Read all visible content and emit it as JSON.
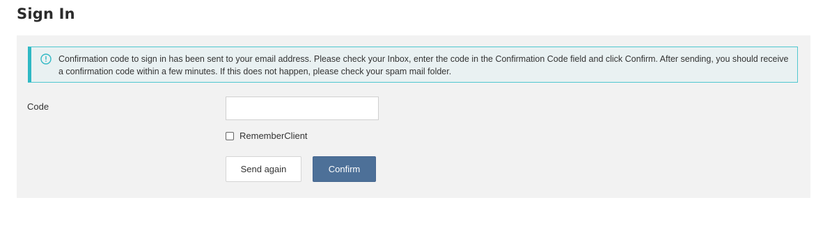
{
  "page": {
    "title": "Sign In"
  },
  "alert": {
    "icon": "info-circle-icon",
    "message": "Confirmation code to sign in has been sent to your email address. Please check your Inbox, enter the code in the Confirmation Code field and click Confirm. After sending, you should receive a confirmation code within a few minutes. If this does not happen, please check your spam mail folder.",
    "border_color": "#4fc7cf",
    "accent_color": "#2fb8c4"
  },
  "form": {
    "code_label": "Code",
    "code_value": "",
    "remember_label": "RememberClient",
    "remember_checked": false
  },
  "buttons": {
    "send_again_label": "Send again",
    "confirm_label": "Confirm",
    "confirm_color": "#4d7098"
  }
}
